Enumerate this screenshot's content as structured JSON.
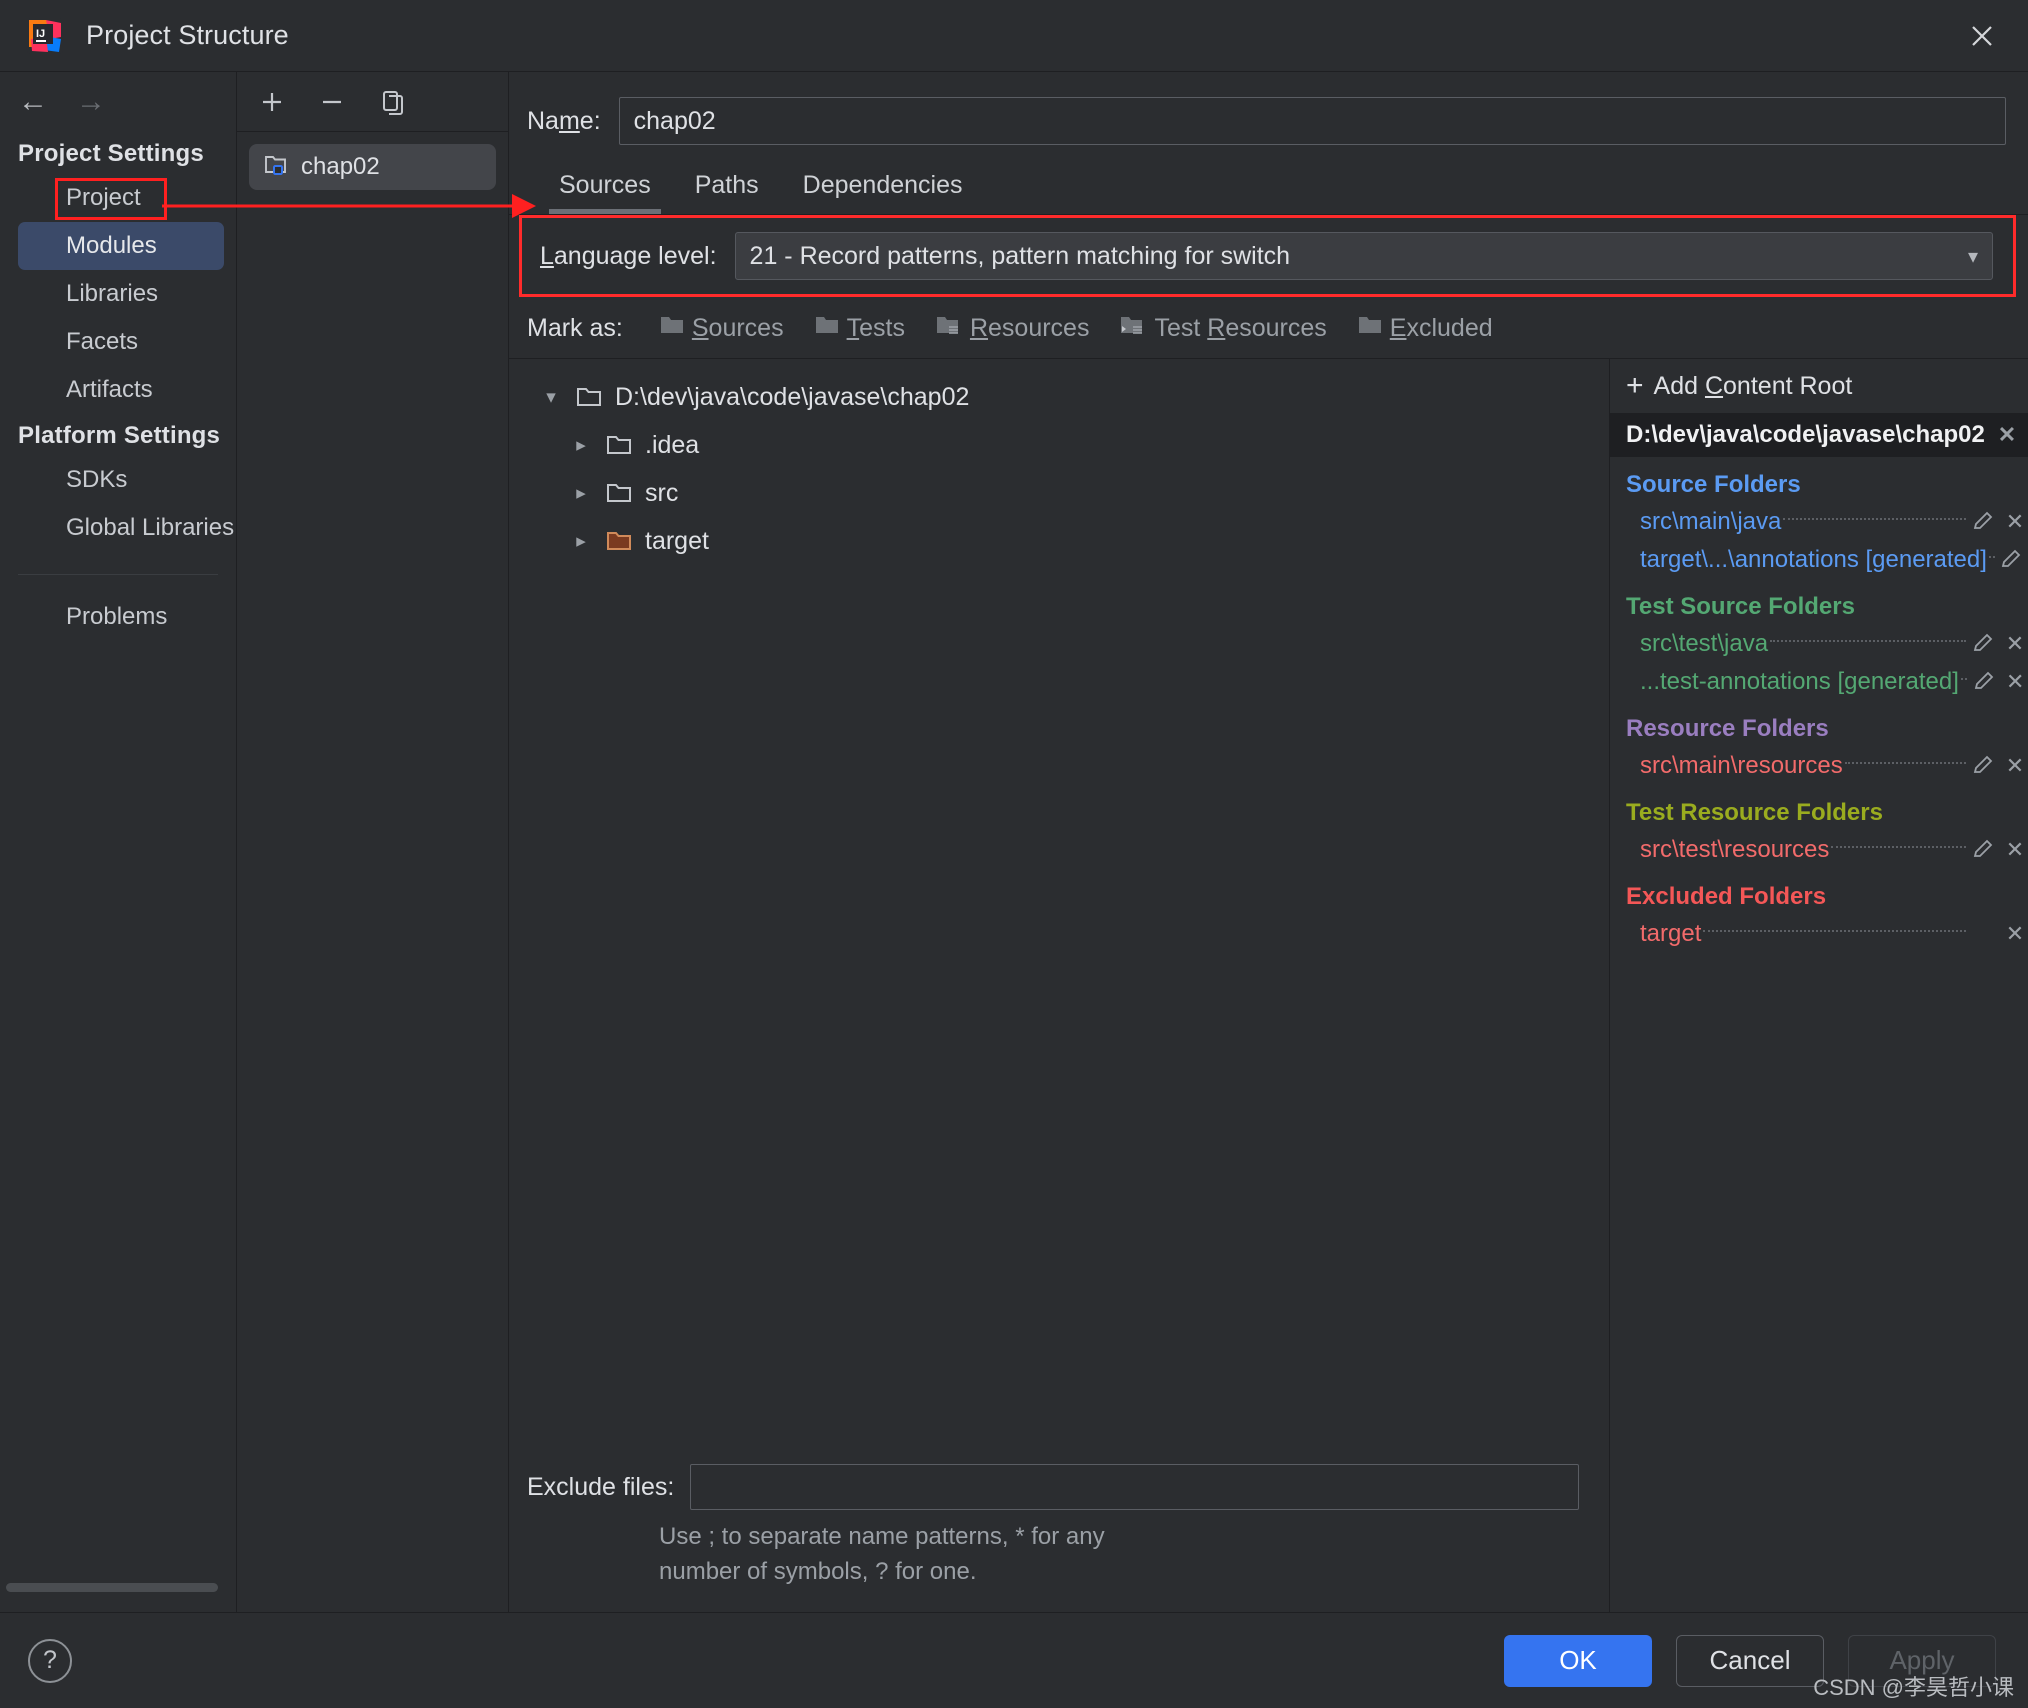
{
  "window": {
    "title": "Project Structure",
    "logo_icon": "intellij-idea-logo",
    "close_icon": "close-icon"
  },
  "nav": {
    "back_icon": "arrow-left-icon",
    "forward_icon": "arrow-right-icon"
  },
  "sidebar": {
    "groups": [
      {
        "title": "Project Settings",
        "items": [
          {
            "label": "Project",
            "selected": false
          },
          {
            "label": "Modules",
            "selected": true
          },
          {
            "label": "Libraries",
            "selected": false
          },
          {
            "label": "Facets",
            "selected": false
          },
          {
            "label": "Artifacts",
            "selected": false
          }
        ]
      },
      {
        "title": "Platform Settings",
        "items": [
          {
            "label": "SDKs",
            "selected": false
          },
          {
            "label": "Global Libraries",
            "selected": false
          }
        ]
      }
    ],
    "problems_label": "Problems"
  },
  "module_panel": {
    "toolbar": [
      {
        "name": "add-module-button",
        "icon": "plus-icon"
      },
      {
        "name": "remove-module-button",
        "icon": "minus-icon"
      },
      {
        "name": "copy-module-button",
        "icon": "copy-icon"
      }
    ],
    "items": [
      {
        "label": "chap02",
        "icon": "module-folder-icon",
        "selected": true
      }
    ]
  },
  "main": {
    "name_label_pre": "Na",
    "name_label_accel": "m",
    "name_label_post": "e:",
    "name_value": "chap02",
    "tabs": [
      {
        "label": "Sources",
        "active": true
      },
      {
        "label": "Paths",
        "active": false
      },
      {
        "label": "Dependencies",
        "active": false
      }
    ],
    "language_level": {
      "label_accel": "L",
      "label_rest": "anguage level:",
      "value": "21 - Record patterns, pattern matching for switch",
      "chevron_icon": "chevron-down-icon"
    },
    "mark_as": {
      "label": "Mark as:",
      "buttons": [
        {
          "pre": "",
          "accel": "S",
          "post": "ources",
          "icon": "folder-sources-icon"
        },
        {
          "pre": "",
          "accel": "T",
          "post": "ests",
          "icon": "folder-tests-icon"
        },
        {
          "pre": "",
          "accel": "R",
          "post": "esources",
          "icon": "folder-resources-icon"
        },
        {
          "pre": "Test ",
          "accel": "R",
          "post": "esources",
          "icon": "folder-test-resources-icon"
        },
        {
          "pre": "",
          "accel": "E",
          "post": "xcluded",
          "icon": "folder-excluded-icon"
        }
      ]
    },
    "tree": [
      {
        "label": "D:\\dev\\java\\code\\javase\\chap02",
        "depth": 0,
        "expanded": true,
        "icon": "folder-icon",
        "color": "default"
      },
      {
        "label": ".idea",
        "depth": 1,
        "expanded": false,
        "icon": "folder-icon",
        "color": "default"
      },
      {
        "label": "src",
        "depth": 1,
        "expanded": false,
        "icon": "folder-icon",
        "color": "default"
      },
      {
        "label": "target",
        "depth": 1,
        "expanded": false,
        "icon": "folder-excluded-icon",
        "color": "excluded"
      }
    ],
    "exclude_files": {
      "label": "Exclude files:",
      "value": "",
      "hint": "Use ; to separate name patterns, * for any number of symbols, ? for one."
    }
  },
  "roots_pane": {
    "add_content_root": {
      "pre": "Add ",
      "accel": "C",
      "post": "ontent Root",
      "icon": "plus-icon"
    },
    "root_path": "D:\\dev\\java\\code\\javase\\chap02",
    "root_remove_icon": "close-icon",
    "groups": [
      {
        "title": "Source Folders",
        "color": "#5b9bf3",
        "entries": [
          {
            "path": "src\\main\\java",
            "color": "#5b9bf3",
            "edit_icon": "pencil-icon",
            "remove_icon": "close-icon",
            "has_edit": true
          },
          {
            "path": "target\\...\\annotations [generated]",
            "color": "#5b9bf3",
            "edit_icon": "pencil-icon",
            "remove_icon": "close-icon",
            "has_edit": true
          }
        ]
      },
      {
        "title": "Test Source Folders",
        "color": "#54a873",
        "entries": [
          {
            "path": "src\\test\\java",
            "color": "#54a873",
            "edit_icon": "pencil-icon",
            "remove_icon": "close-icon",
            "has_edit": true
          },
          {
            "path": "...test-annotations [generated]",
            "color": "#54a873",
            "edit_icon": "pencil-icon",
            "remove_icon": "close-icon",
            "has_edit": true
          }
        ]
      },
      {
        "title": "Resource Folders",
        "color": "#9a7ec0",
        "entries": [
          {
            "path": "src\\main\\resources",
            "color": "#f26b6b",
            "edit_icon": "pencil-icon",
            "remove_icon": "close-icon",
            "has_edit": true
          }
        ]
      },
      {
        "title": "Test Resource Folders",
        "color": "#9aac1f",
        "entries": [
          {
            "path": "src\\test\\resources",
            "color": "#f26b6b",
            "edit_icon": "pencil-icon",
            "remove_icon": "close-icon",
            "has_edit": true
          }
        ]
      },
      {
        "title": "Excluded Folders",
        "color": "#f45757",
        "entries": [
          {
            "path": "target",
            "color": "#f26b6b",
            "edit_icon": "",
            "remove_icon": "close-icon",
            "has_edit": false
          }
        ]
      }
    ]
  },
  "footer": {
    "help_label": "?",
    "ok_label": "OK",
    "cancel_label": "Cancel",
    "apply_label": "Apply",
    "watermark": "CSDN @李昊哲小课"
  },
  "annotations": {
    "accent_color": "#ff2020"
  }
}
